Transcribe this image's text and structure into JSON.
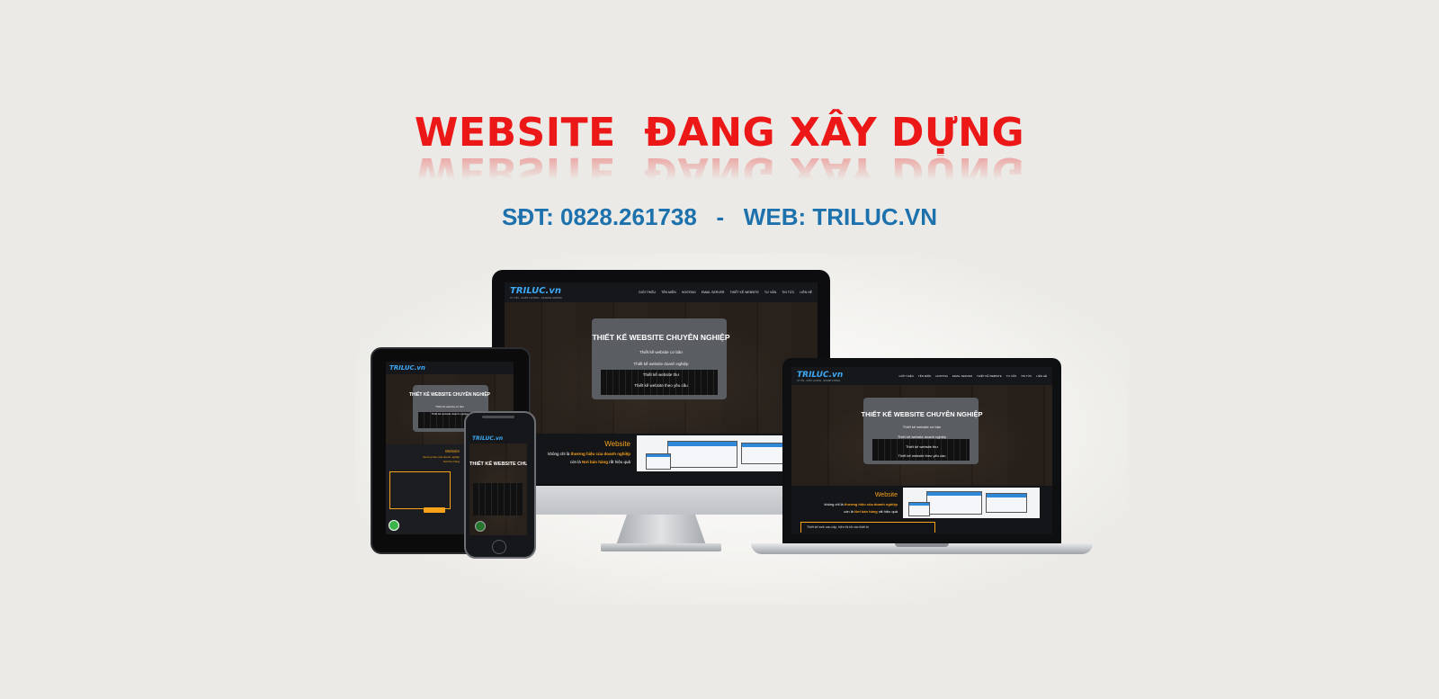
{
  "headline": "WEBSITE  ĐANG XÂY DỰNG",
  "contact": "SĐT: 0828.261738   -   WEB: TRILUC.VN",
  "mockup": {
    "logo": "TRILUC.vn",
    "logo_tagline": "UY TÍN - CHẤT LƯỢNG - NHANH CHÓNG",
    "nav": [
      "GIỚI THIỆU",
      "TÊN MIỀN",
      "HOSTING",
      "EMAIL SERVER",
      "THIẾT KẾ WEBSITE",
      "TƯ VẤN",
      "TIN TỨC",
      "LIÊN HỆ"
    ],
    "hero_title": "THIẾT KẾ WEBSITE CHUYÊN NGHIỆP",
    "hero_lines": [
      "Thiết kế website cơ bản",
      "Thiết kế website doanh nghiệp",
      "Thiết kế website thư",
      "Thiết kế website theo yêu cầu"
    ],
    "promo_title": "Website",
    "promo_line1_prefix": "không chỉ là",
    "promo_line1_highlight": "thương hiệu của doanh nghiệp",
    "promo_line2_prefix": "còn là",
    "promo_line2_highlight": "Nơi bán hàng",
    "promo_line2_suffix": "rất hiệu quả",
    "laptop_list_item": "Thiết kế web cao cấp, hiện thị tốt các thiết bị"
  },
  "colors": {
    "headline": "#ec1717",
    "contact": "#1d71ad",
    "background": "#ebeae6",
    "accent_orange": "#f7a21b",
    "logo_blue": "#3fa9f5"
  }
}
